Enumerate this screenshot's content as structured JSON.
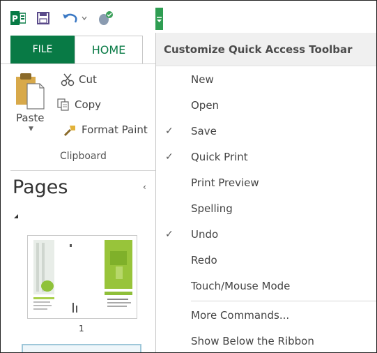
{
  "qat": {
    "icons": [
      "publisher-logo-icon",
      "save-icon",
      "undo-icon",
      "touch-mouse-icon",
      "customize-dropdown-icon"
    ],
    "colors": {
      "brand": "#087a45",
      "accent": "#2e9d52"
    }
  },
  "ribbon": {
    "tabs": [
      "FILE",
      "HOME"
    ],
    "active_tab": "HOME",
    "clipboard": {
      "paste": "Paste",
      "cut": "Cut",
      "copy": "Copy",
      "format_painter": "Format Paint",
      "group_label": "Clipboard"
    }
  },
  "pages_pane": {
    "title": "Pages",
    "collapse_glyph": "‹",
    "thumbnails": [
      {
        "number": "1"
      }
    ]
  },
  "menu": {
    "header": "Customize Quick Access Toolbar",
    "items": [
      {
        "label": "New",
        "checked": false
      },
      {
        "label": "Open",
        "checked": false
      },
      {
        "label": "Save",
        "checked": true
      },
      {
        "label": "Quick Print",
        "checked": true
      },
      {
        "label": "Print Preview",
        "checked": false
      },
      {
        "label": "Spelling",
        "checked": false
      },
      {
        "label": "Undo",
        "checked": true
      },
      {
        "label": "Redo",
        "checked": false
      },
      {
        "label": "Touch/Mouse Mode",
        "checked": false
      },
      {
        "label": "More Commands...",
        "checked": false
      },
      {
        "label": "Show Below the Ribbon",
        "checked": false
      }
    ],
    "check_glyph": "✓"
  }
}
